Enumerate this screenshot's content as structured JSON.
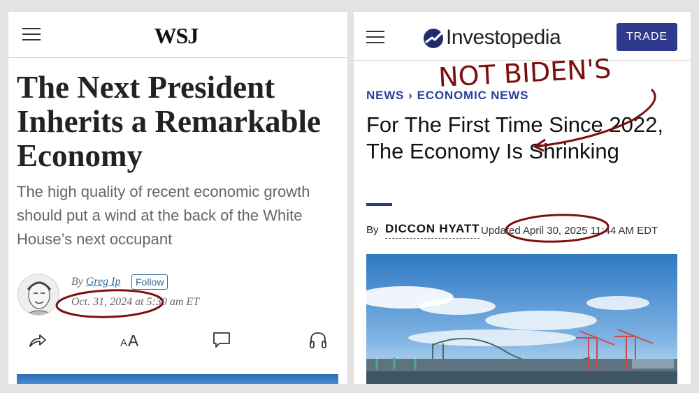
{
  "left_panel": {
    "logo": "WSJ",
    "headline": "The Next President Inherits a Remarkable Economy",
    "dek": "The high quality of recent economic growth should put a wind at the back of the White House’s next occupant",
    "byline_prefix": "By",
    "author": "Greg Ip",
    "follow_label": "Follow",
    "date": "Oct. 31, 2024 at 5:30 am ET",
    "icons": [
      "menu-icon",
      "share-icon",
      "text-size-icon",
      "comment-icon",
      "headphones-icon"
    ]
  },
  "right_panel": {
    "logo_text": "Investopedia",
    "trade_label": "TRADE",
    "breadcrumb": [
      "NEWS",
      "ECONOMIC NEWS"
    ],
    "breadcrumb_separator": "›",
    "headline": "For The First Time Since 2022, The Economy Is Shrinking",
    "byline_prefix": "By",
    "author": "DICCON HYATT",
    "updated": "Updated April 30, 2025 11:44 AM EDT",
    "accent_color": "#2e3a8c"
  },
  "annotation": {
    "handwritten_text": "NOT BIDEN'S",
    "ink_color": "#7a1010"
  }
}
